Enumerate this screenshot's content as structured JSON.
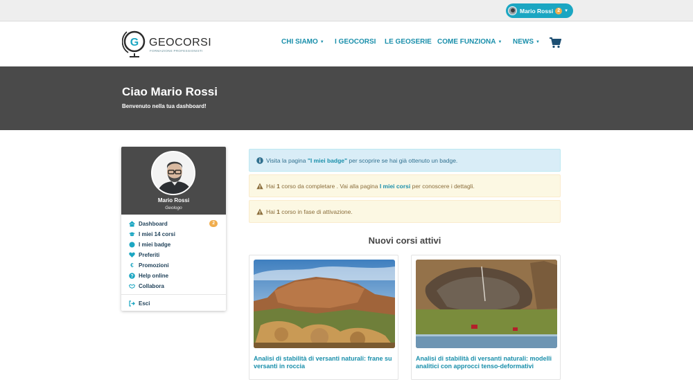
{
  "topbar": {
    "user_name": "Mario Rossi",
    "notification_count": "2"
  },
  "header": {
    "logo_geo": "GEO",
    "logo_corsi": "CORSI",
    "logo_tagline": "FORMAZIONE PROFESSIONISTI",
    "nav": [
      {
        "label": "CHI SIAMO",
        "dropdown": true
      },
      {
        "label": "I GEOCORSI",
        "dropdown": false
      },
      {
        "label": "LE GEOSERIE",
        "dropdown": false
      },
      {
        "label": "COME FUNZIONA",
        "dropdown": true
      },
      {
        "label": "NEWS",
        "dropdown": true
      }
    ]
  },
  "hero": {
    "title": "Ciao Mario Rossi",
    "subtitle": "Benvenuto nella tua dashboard!"
  },
  "profile": {
    "name": "Mario Rossi",
    "role": "Geologo",
    "menu": [
      {
        "label": "Dashboard",
        "icon": "home-icon",
        "badge": "2"
      },
      {
        "label": "I miei 14 corsi",
        "icon": "graduation-cap-icon"
      },
      {
        "label": "I miei badge",
        "icon": "circle-icon"
      },
      {
        "label": "Preferiti",
        "icon": "heart-icon"
      },
      {
        "label": "Promozioni",
        "icon": "euro-icon"
      },
      {
        "label": "Help online",
        "icon": "question-icon"
      },
      {
        "label": "Collabora",
        "icon": "handshake-icon"
      }
    ],
    "logout_label": "Esci"
  },
  "alerts": {
    "info": {
      "pre": "Visita la pagina ",
      "link": "\"I miei badge\"",
      "post": " per scoprire se hai già ottenuto un badge."
    },
    "warn1": {
      "pre": "Hai ",
      "count": "1",
      "mid": " corso da completare . Vai alla pagina ",
      "link": "I miei corsi",
      "post": " per conoscere i dettagli."
    },
    "warn2": {
      "pre": "Hai ",
      "count": "1",
      "post": " corso in fase di attivazione."
    }
  },
  "courses_section": {
    "title": "Nuovi corsi attivi",
    "courses": [
      {
        "title": "Analisi di stabilità di versanti naturali: frane su versanti in roccia"
      },
      {
        "title": "Analisi di stabilità di versanti naturali: modelli analitici con approcci tenso-deformativi"
      }
    ]
  },
  "colors": {
    "accent": "#1ba6c2",
    "nav_link": "#1a8fab",
    "hero_bg": "#4a4a4a",
    "badge": "#f0ad4e"
  }
}
